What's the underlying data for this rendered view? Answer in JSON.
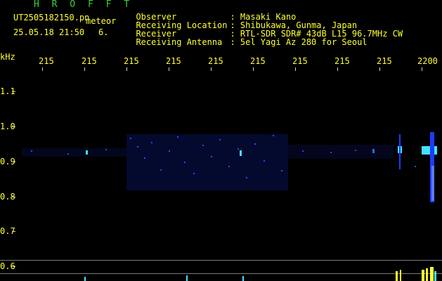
{
  "header": {
    "title": "H R O F F T",
    "filename": "UT2505182150.pn",
    "meteor_label": "meteor",
    "datetime": "25.05.18 21:50",
    "count": "6."
  },
  "meta": [
    {
      "label": "Observer",
      "value": ": Masaki Kano"
    },
    {
      "label": "Receiving Location",
      "value": ": Shibukawa, Gunma, Japan"
    },
    {
      "label": "Receiver",
      "value": ": RTL-SDR SDR# 43dB L15 96.7MHz CW"
    },
    {
      "label": "Receiving Antenna",
      "value": ": 5el Yagi Az 280 for Seoul"
    }
  ],
  "axis": {
    "unit": "kHz",
    "time_ticks": [
      "215",
      "215",
      "215",
      "215",
      "215",
      "215",
      "215",
      "215",
      "215",
      "2200"
    ],
    "freq_ticks": [
      "1.1",
      "1.0",
      "0.9",
      "0.8",
      "0.7",
      "0.6"
    ]
  },
  "colors": {
    "header_green": "#3ccf3c",
    "label_yellow": "#ffff33",
    "signal_blue": "#1a3cff",
    "signal_cyan": "#44e0ff",
    "background": "#000000"
  }
}
